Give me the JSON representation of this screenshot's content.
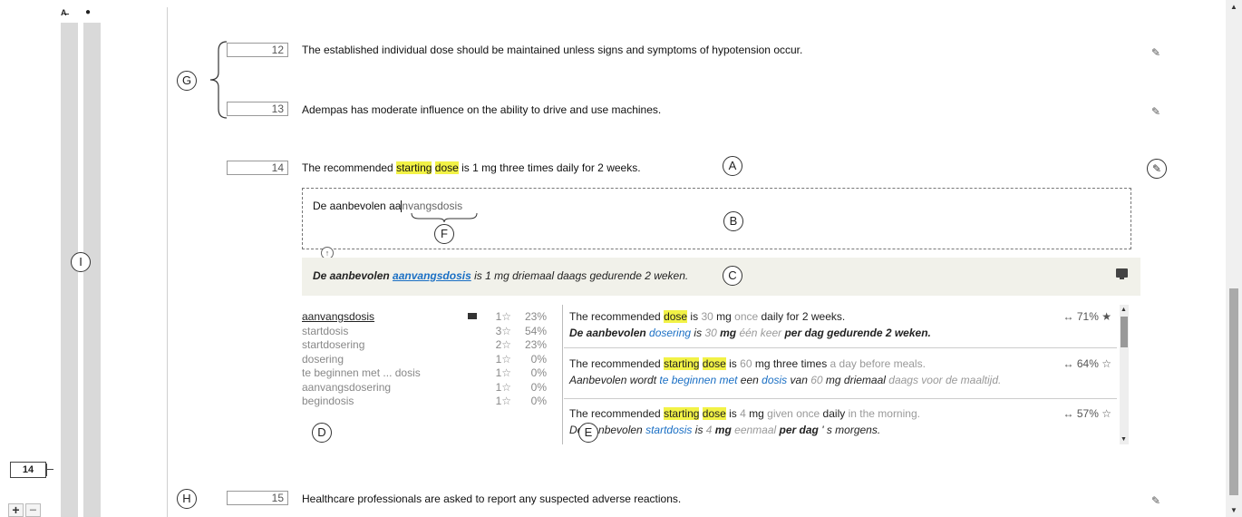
{
  "left_panel": {
    "col1_label": "A̶",
    "col2_label": "●",
    "segment_number": "14",
    "zoom_in": "+",
    "zoom_out": "−"
  },
  "annotations": {
    "A": "A",
    "B": "B",
    "C": "C",
    "D": "D",
    "E": "E",
    "F": "F",
    "G": "G",
    "H": "H",
    "I": "I"
  },
  "segments": [
    {
      "num": "12",
      "text": "The established individual dose should be maintained unless signs and symptoms of hypotension occur."
    },
    {
      "num": "13",
      "text": "Adempas has moderate influence on the ability to drive and use machines."
    },
    {
      "num": "14",
      "text_pre": "The recommended ",
      "hl1": "starting",
      "text_mid": " ",
      "hl2": "dose",
      "text_post": " is 1 mg three times daily for 2 weeks."
    },
    {
      "num": "15",
      "text": "Healthcare professionals are asked to report any suspected adverse reactions."
    }
  ],
  "editor": {
    "typed": "De aanbevolen aa",
    "suggestion": "nvangsdosis"
  },
  "machine_translation": {
    "bold_pre": "De aanbevolen",
    "link": "aanvangsdosis",
    "rest": " is 1 mg driemaal daags gedurende 2 weken."
  },
  "terms": [
    {
      "term": "aanvangsdosis",
      "stars": "1☆",
      "pct": "23%"
    },
    {
      "term": "startdosis",
      "stars": "3☆",
      "pct": "54%"
    },
    {
      "term": "startdosering",
      "stars": "2☆",
      "pct": "23%"
    },
    {
      "term": "dosering",
      "stars": "1☆",
      "pct": "0%"
    },
    {
      "term": "te beginnen met ... dosis",
      "stars": "1☆",
      "pct": "0%"
    },
    {
      "term": "aanvangsdosering",
      "stars": "1☆",
      "pct": "0%"
    },
    {
      "term": "begindosis",
      "stars": "1☆",
      "pct": "0%"
    }
  ],
  "tm_matches": [
    {
      "src": [
        "The recommended ",
        "dose",
        " is ",
        "30",
        " mg ",
        "once",
        " daily for 2 weeks."
      ],
      "tgt": [
        "De aanbevolen ",
        "dosering",
        " is ",
        "30",
        " mg ",
        "één keer",
        " per dag gedurende 2 weken."
      ],
      "score": "↔ 71% ★"
    },
    {
      "src": [
        "The recommended ",
        "starting",
        " ",
        "dose",
        " is ",
        "60",
        " mg three times ",
        "a day before meals."
      ],
      "tgt": [
        "Aanbevolen wordt ",
        "te beginnen met",
        " een ",
        "dosis",
        " van ",
        "60",
        " mg driemaal ",
        "daags voor de maaltijd."
      ],
      "score": "↔ 64% ☆"
    },
    {
      "src": [
        "The recommended ",
        "starting",
        " ",
        "dose",
        " is ",
        "4",
        " mg ",
        "given once",
        " daily ",
        "in the morning."
      ],
      "tgt": [
        "De aanbevolen ",
        "startdosis",
        " is ",
        "4",
        " mg ",
        "eenmaal",
        " per dag ",
        "' s morgens."
      ],
      "score": "↔ 57% ☆"
    }
  ]
}
